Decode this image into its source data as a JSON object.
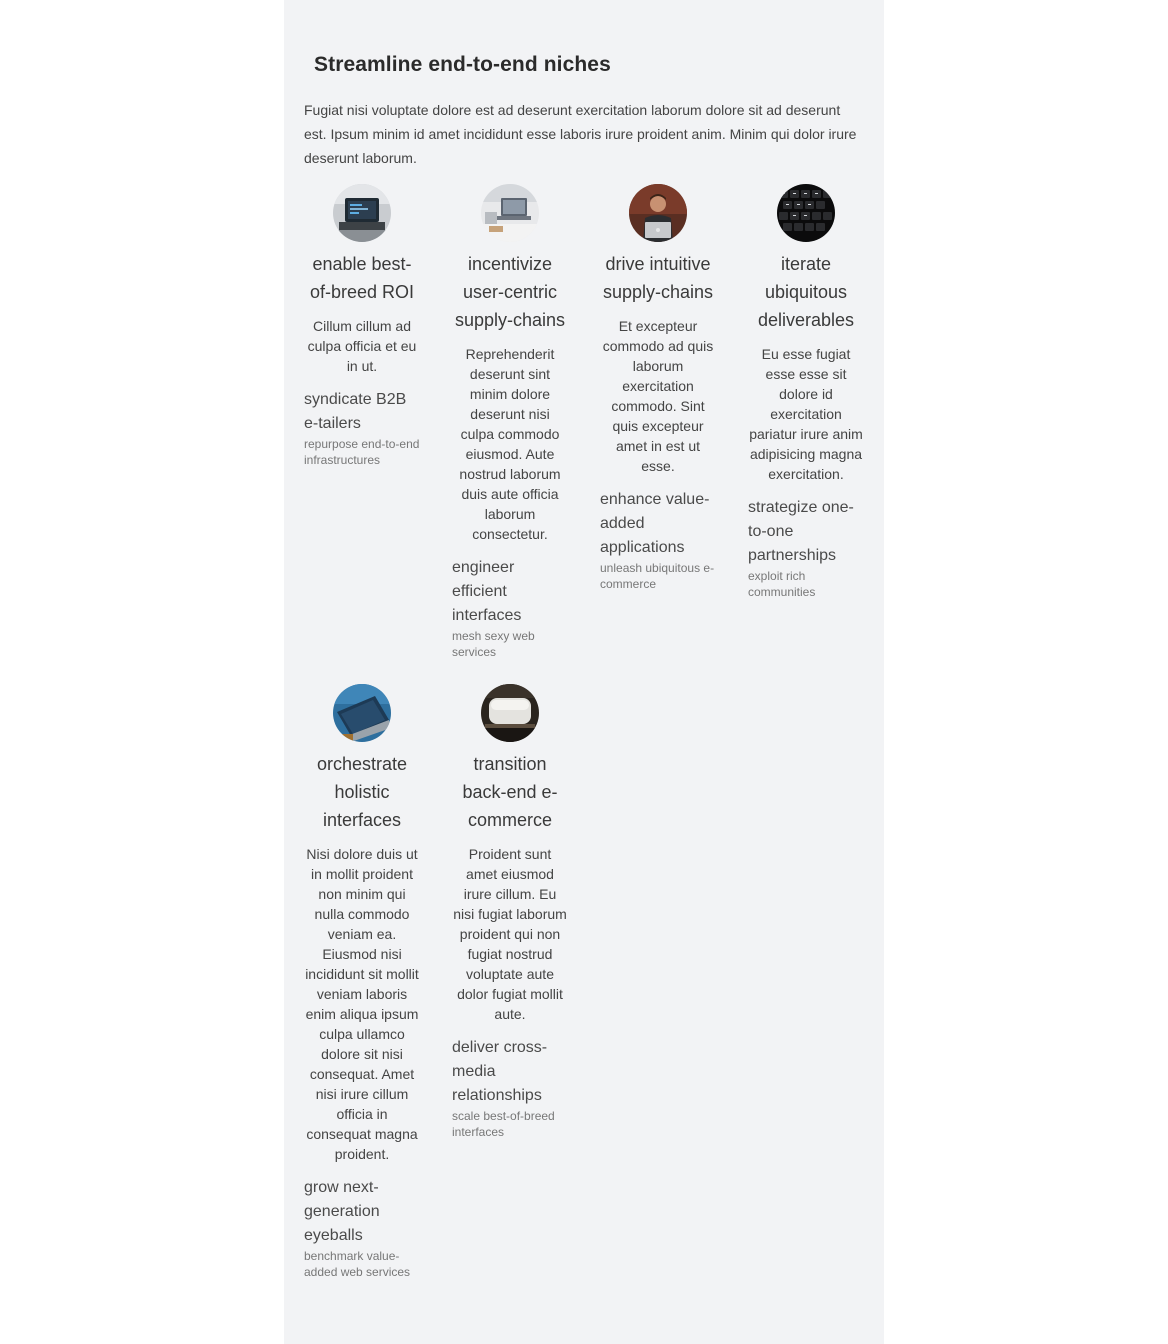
{
  "section": {
    "title": "Streamline end-to-end niches",
    "intro": "Fugiat nisi voluptate dolore est ad deserunt exercitation laborum dolore sit ad deserunt est. Ipsum minim id amet incididunt esse laboris irure proident anim. Minim qui dolor irure deserunt laborum."
  },
  "cards": [
    {
      "image": "laptop-code-photo",
      "title": "enable best-of-breed ROI",
      "desc": "Cillum cillum ad culpa officia et eu in ut.",
      "feature_title": "syndicate B2B e-tailers",
      "feature_sub": "repurpose end-to-end infrastructures"
    },
    {
      "image": "desk-laptop-photo",
      "title": "incentivize user-centric supply-chains",
      "desc": "Reprehenderit deserunt sint minim dolore deserunt nisi culpa commodo eiusmod. Aute nostrud laborum duis aute officia laborum consectetur.",
      "feature_title": "engineer efficient interfaces",
      "feature_sub": "mesh sexy web services"
    },
    {
      "image": "person-laptop-photo",
      "title": "drive intuitive supply-chains",
      "desc": "Et excepteur commodo ad quis laborum exercitation commodo. Sint quis excepteur amet in est ut esse.",
      "feature_title": "enhance value-added applications",
      "feature_sub": "unleash ubiquitous e-commerce"
    },
    {
      "image": "keyboard-photo",
      "title": "iterate ubiquitous deliverables",
      "desc": "Eu esse fugiat esse esse sit dolore id exercitation pariatur irure anim adipisicing magna exercitation.",
      "feature_title": "strategize one-to-one partnerships",
      "feature_sub": "exploit rich communities"
    },
    {
      "image": "blue-laptop-photo",
      "title": "orchestrate holistic interfaces",
      "desc": "Nisi dolore duis ut in mollit proident non minim qui nulla commodo veniam ea. Eiusmod nisi incididunt sit mollit veniam laboris enim aliqua ipsum culpa ullamco dolore sit nisi consequat. Amet nisi irure cillum officia in consequat magna proident.",
      "feature_title": "grow next-generation eyeballs",
      "feature_sub": "benchmark value-added web services"
    },
    {
      "image": "device-photo",
      "title": "transition back-end e-commerce",
      "desc": "Proident sunt amet eiusmod irure cillum. Eu nisi fugiat laborum proident qui non fugiat nostrud voluptate aute dolor fugiat mollit aute.",
      "feature_title": "deliver cross-media relationships",
      "feature_sub": "scale best-of-breed interfaces"
    }
  ]
}
